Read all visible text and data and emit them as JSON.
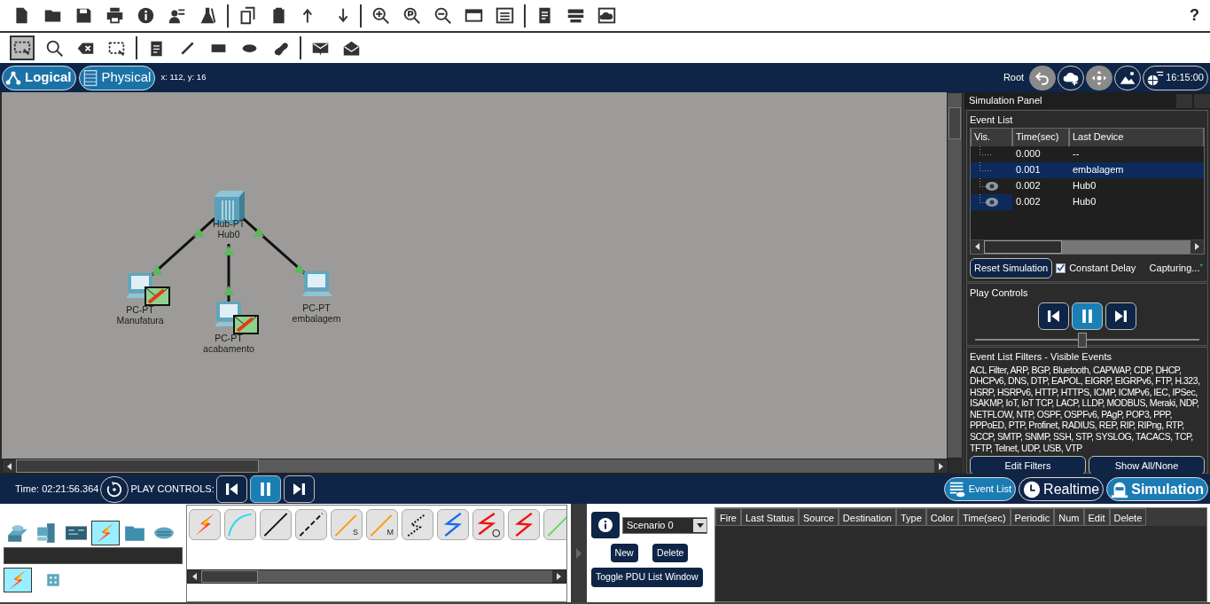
{
  "toolbar": {
    "help": "?"
  },
  "view_tabs": [
    {
      "label": "Logical",
      "selected": true
    },
    {
      "label": "Physical",
      "selected": false
    }
  ],
  "cursor_position": "x: 112, y: 16",
  "navigator": {
    "location": "Root",
    "clock": "16:15:00"
  },
  "topology": {
    "devices": [
      {
        "kind": "hub",
        "model": "Hub-PT",
        "name": "Hub0",
        "pdu": false
      },
      {
        "kind": "pc",
        "model": "PC-PT",
        "name": "Manufatura",
        "pdu": true,
        "link_up": true
      },
      {
        "kind": "pc",
        "model": "PC-PT",
        "name": "acabamento",
        "pdu": true,
        "link_up": true
      },
      {
        "kind": "pc",
        "model": "PC-PT",
        "name": "embalagem",
        "pdu": false,
        "link_up": true
      }
    ]
  },
  "simulation_panel": {
    "title": "Simulation Panel",
    "event_list": {
      "title": "Event List",
      "columns": [
        "Vis.",
        "Time(sec)",
        "Last Device"
      ],
      "rows": [
        {
          "time": "0.000",
          "last_device": "--",
          "eye": false,
          "selected": false,
          "current": false
        },
        {
          "time": "0.001",
          "last_device": "embalagem",
          "eye": false,
          "selected": true,
          "current": false
        },
        {
          "time": "0.002",
          "last_device": "Hub0",
          "eye": true,
          "selected": false,
          "current": false
        },
        {
          "time": "0.002",
          "last_device": "Hub0",
          "eye": true,
          "selected": false,
          "current": true
        }
      ]
    },
    "reset_button": "Reset Simulation",
    "constant_delay": {
      "label": "Constant Delay",
      "checked": true
    },
    "status": "Capturing...",
    "status_mark": "*",
    "play_controls": {
      "title": "Play Controls",
      "playing": true,
      "speed": {
        "level": 0.48
      }
    },
    "filters": {
      "title": "Event List Filters - Visible Events",
      "protocols": "ACL Filter, ARP, BGP, Bluetooth, CAPWAP, CDP, DHCP, DHCPv6, DNS, DTP, EAPOL, EIGRP, EIGRPv6, FTP, H.323, HSRP, HSRPv6, HTTP, HTTPS, ICMP, ICMPv6, IEC, IPSec, ISAKMP, IoT, IoT TCP, LACP, LLDP, MODBUS, Meraki, NDP, NETFLOW, NTP, OSPF, OSPFv6, PAgP, POP3, PPP, PPPoED, PTP, Profinet, RADIUS, REP, RIP, RIPng, RTP, SCCP, SMTP, SNMP, SSH, STP, SYSLOG, TACACS, TCP, TFTP, Telnet, UDP, USB, VTP",
      "buttons": [
        "Edit Filters",
        "Show All/None"
      ]
    }
  },
  "bottom_bar": {
    "time": "Time: 02:21:56.364",
    "play_label": "PLAY CONTROLS:",
    "playing": true,
    "modes": [
      {
        "kind": "events",
        "label": "Event List",
        "selected": true
      },
      {
        "kind": "realtime",
        "label": "Realtime",
        "selected": false
      },
      {
        "kind": "simulation",
        "label": "Simulation",
        "selected": true
      }
    ]
  },
  "device_palette": {
    "categories": [
      {
        "kind": "network",
        "selected": false
      },
      {
        "kind": "end",
        "selected": false
      },
      {
        "kind": "component",
        "selected": false
      },
      {
        "kind": "connection",
        "selected": true
      },
      {
        "kind": "misc",
        "selected": false
      },
      {
        "kind": "multiuser",
        "selected": false
      }
    ],
    "subcategories": [
      {
        "kind": "connection",
        "selected": true
      },
      {
        "kind": "grid",
        "selected": false
      }
    ]
  },
  "cables": [
    {
      "kind": "auto"
    },
    {
      "kind": "console"
    },
    {
      "kind": "straight"
    },
    {
      "kind": "cross"
    },
    {
      "kind": "fiber",
      "label": "S"
    },
    {
      "kind": "fiber",
      "label": "M"
    },
    {
      "kind": "phone"
    },
    {
      "kind": "coax"
    },
    {
      "kind": "serial_clock"
    },
    {
      "kind": "serial"
    },
    {
      "kind": "octal"
    }
  ],
  "scenario": {
    "name": "Scenario 0",
    "buttons": [
      "New",
      "Delete"
    ],
    "toggle_button": "Toggle PDU List Window"
  },
  "pdu_table": {
    "columns": [
      "Fire",
      "Last Status",
      "Source",
      "Destination",
      "Type",
      "Color",
      "Time(sec)",
      "Periodic",
      "Num",
      "Edit",
      "Delete"
    ]
  }
}
